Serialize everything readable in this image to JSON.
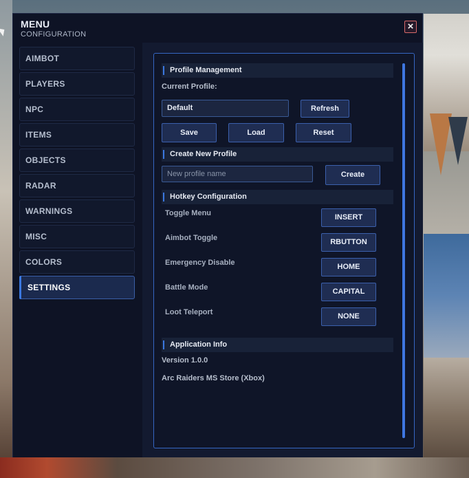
{
  "window": {
    "title": "MENU",
    "subtitle": "CONFIGURATION",
    "close_icon": "×"
  },
  "sidebar": {
    "items": [
      {
        "label": "AIMBOT",
        "active": false
      },
      {
        "label": "PLAYERS",
        "active": false
      },
      {
        "label": "NPC",
        "active": false
      },
      {
        "label": "ITEMS",
        "active": false
      },
      {
        "label": "OBJECTS",
        "active": false
      },
      {
        "label": "RADAR",
        "active": false
      },
      {
        "label": "WARNINGS",
        "active": false
      },
      {
        "label": "MISC",
        "active": false
      },
      {
        "label": "COLORS",
        "active": false
      },
      {
        "label": "SETTINGS",
        "active": true
      }
    ]
  },
  "profile": {
    "section_title": "Profile Management",
    "current_label": "Current Profile:",
    "current_value": "Default",
    "refresh_label": "Refresh",
    "save_label": "Save",
    "load_label": "Load",
    "reset_label": "Reset"
  },
  "new_profile": {
    "section_title": "Create New Profile",
    "placeholder": "New profile name",
    "create_label": "Create"
  },
  "hotkeys": {
    "section_title": "Hotkey Configuration",
    "items": [
      {
        "label": "Toggle Menu",
        "key": "INSERT"
      },
      {
        "label": "Aimbot Toggle",
        "key": "RBUTTON"
      },
      {
        "label": "Emergency Disable",
        "key": "HOME"
      },
      {
        "label": "Battle Mode",
        "key": "CAPITAL"
      },
      {
        "label": "Loot Teleport",
        "key": "NONE"
      }
    ]
  },
  "app_info": {
    "section_title": "Application Info",
    "version": "Version 1.0.0",
    "edition": "Arc Raiders MS Store (Xbox)"
  },
  "colors": {
    "accent": "#3b78e0",
    "window_bg": "#0e1325",
    "panel_border": "#3667c4"
  }
}
